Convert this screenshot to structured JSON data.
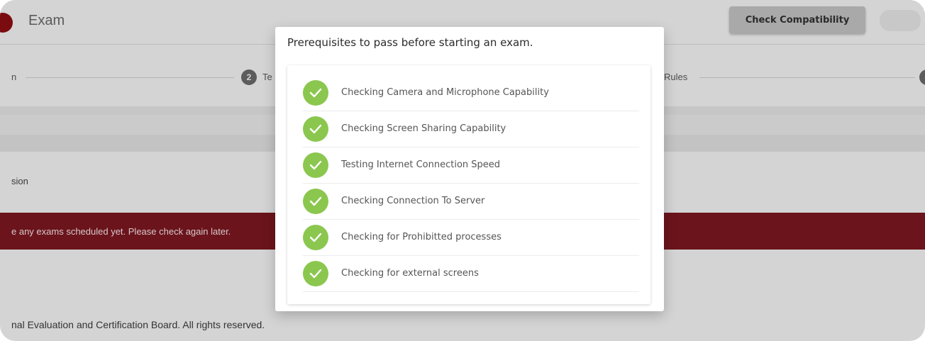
{
  "header": {
    "app_title": "Exam",
    "check_button_label": "Check Compatibility"
  },
  "stepper": {
    "step_1_label_fragment": "n",
    "step_2_number": "2",
    "step_2_label_fragment": "Te",
    "step_3_label_fragment": "Rules"
  },
  "page": {
    "session_text": "sion",
    "alert_text": "e any exams scheduled yet. Please check again later.",
    "footer_text": "nal Evaluation and Certification Board. All rights reserved."
  },
  "modal": {
    "title": "Prerequisites to pass before starting an exam.",
    "checks": [
      {
        "label": "Checking Camera and Microphone Capability",
        "status": "passed"
      },
      {
        "label": "Checking Screen Sharing Capability",
        "status": "passed"
      },
      {
        "label": "Testing Internet Connection Speed",
        "status": "passed"
      },
      {
        "label": "Checking Connection To Server",
        "status": "passed"
      },
      {
        "label": "Checking for Prohibitted processes",
        "status": "passed"
      },
      {
        "label": "Checking for external screens",
        "status": "passed"
      }
    ]
  },
  "colors": {
    "check_green": "#8bc74f",
    "alert_red": "#6b141b",
    "brand_dark_red": "#7a0c10"
  },
  "icons": {
    "check": "check-circle-icon",
    "logo": "logo-icon"
  }
}
